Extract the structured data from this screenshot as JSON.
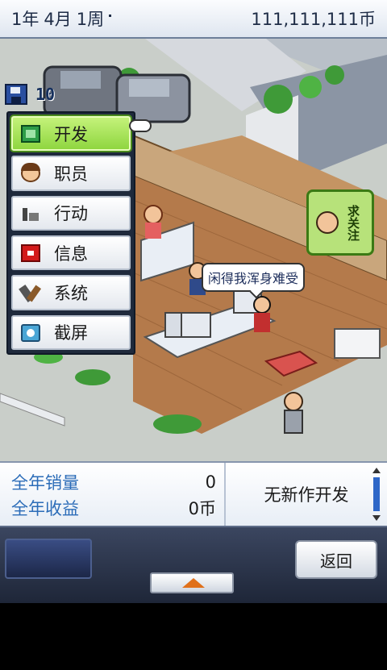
{
  "topbar": {
    "date": {
      "year": "1年",
      "month": "4月",
      "week": "1周"
    },
    "money": "111,111,111币"
  },
  "scene": {
    "save_count": "10",
    "speech_bubble": "闲得我浑身难受",
    "recruit_badge": {
      "line1": "求",
      "line2": "关注"
    }
  },
  "menu": {
    "items": [
      {
        "label": "开发",
        "icon": "development-icon",
        "active": true
      },
      {
        "label": "职员",
        "icon": "staff-icon",
        "active": false
      },
      {
        "label": "行动",
        "icon": "action-icon",
        "active": false
      },
      {
        "label": "信息",
        "icon": "info-mailbox-icon",
        "active": false
      },
      {
        "label": "系统",
        "icon": "system-tools-icon",
        "active": false
      },
      {
        "label": "截屏",
        "icon": "screenshot-camera-icon",
        "active": false
      }
    ]
  },
  "info": {
    "annual_sales_label": "全年销量",
    "annual_sales_value": "0",
    "annual_profit_label": "全年收益",
    "annual_profit_value": "0币",
    "status": "无新作开发"
  },
  "controls": {
    "back_label": "返回"
  },
  "colors": {
    "menu_active": "#8fd640",
    "label_blue": "#2b6cb8",
    "accent_orange": "#e0701a"
  }
}
